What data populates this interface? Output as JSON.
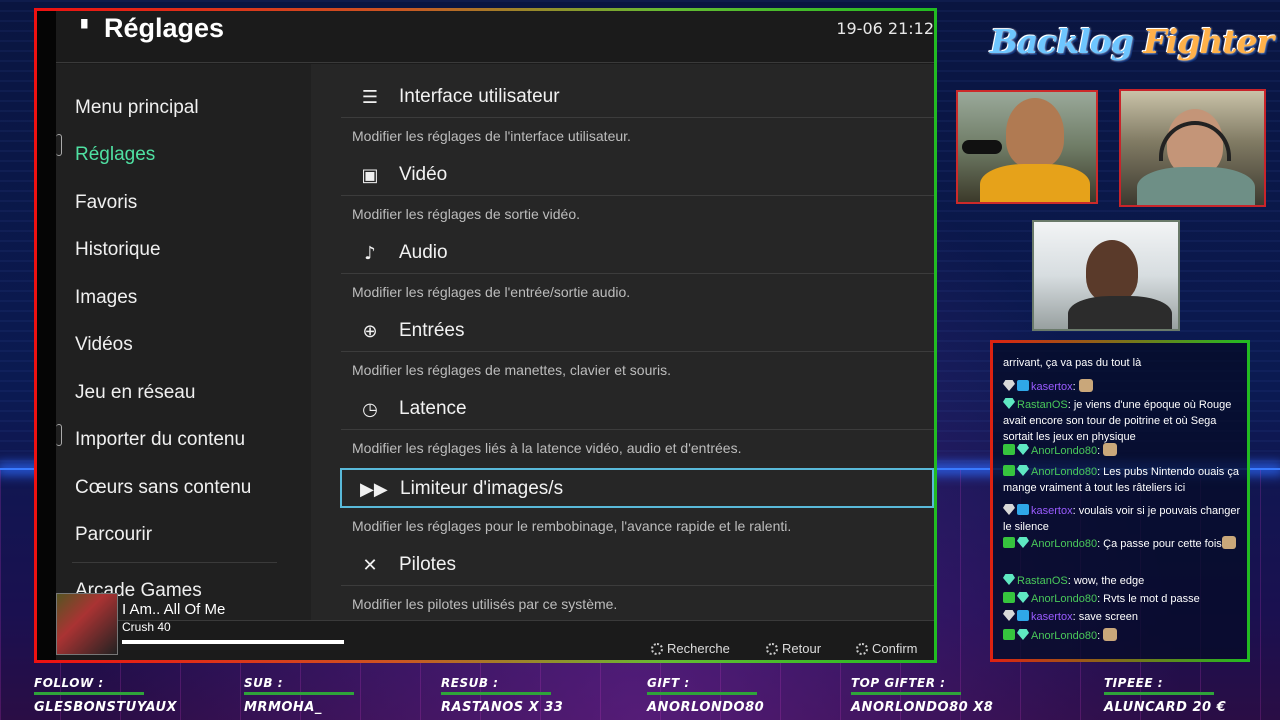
{
  "game": {
    "title": "Réglages",
    "clock": "19-06 21:12",
    "sidebar": [
      {
        "label": "Menu principal",
        "active": false
      },
      {
        "label": "Réglages",
        "active": true
      },
      {
        "label": "Favoris",
        "active": false
      },
      {
        "label": "Historique",
        "active": false
      },
      {
        "label": "Images",
        "active": false
      },
      {
        "label": "Vidéos",
        "active": false
      },
      {
        "label": "Jeu en réseau",
        "active": false
      },
      {
        "label": "Importer du contenu",
        "active": false
      },
      {
        "label": "Cœurs sans contenu",
        "active": false
      },
      {
        "label": "Parcourir",
        "active": false
      },
      {
        "label": "Arcade Games",
        "active": false
      }
    ],
    "settings": [
      {
        "icon": "list-icon",
        "glyph": "☰",
        "label": "Interface utilisateur",
        "desc": "Modifier les réglages de l'interface utilisateur."
      },
      {
        "icon": "film-icon",
        "glyph": "▣",
        "label": "Vidéo",
        "desc": "Modifier les réglages de sortie vidéo."
      },
      {
        "icon": "music-note-icon",
        "glyph": "♪",
        "label": "Audio",
        "desc": "Modifier les réglages de l'entrée/sortie audio."
      },
      {
        "icon": "gamepad-icon",
        "glyph": "⊕",
        "label": "Entrées",
        "desc": "Modifier les réglages de manettes, clavier et souris."
      },
      {
        "icon": "stopwatch-icon",
        "glyph": "◷",
        "label": "Latence",
        "desc": "Modifier les réglages liés à la latence vidéo, audio et d'entrées."
      },
      {
        "icon": "fast-forward-icon",
        "glyph": "▶▶",
        "label": "Limiteur d'images/s",
        "desc": "Modifier les réglages pour le rembobinage, l'avance rapide et le ralenti."
      },
      {
        "icon": "tools-icon",
        "glyph": "✕",
        "label": "Pilotes",
        "desc": "Modifier les pilotes utilisés par ce système."
      }
    ],
    "now_playing": {
      "title": "I Am.. All Of Me",
      "subtitle": "Crush 40"
    },
    "hints": [
      "Recherche",
      "Retour",
      "Confirm"
    ]
  },
  "logo": {
    "word1": "Backlog",
    "word2": "Fighter"
  },
  "chat": [
    {
      "badges": [],
      "user": "",
      "text": "arrivant, ça va pas du tout là",
      "user_color": ""
    },
    {
      "badges": [
        "b-gray",
        "b-crown"
      ],
      "user": "kasertox",
      "text": ": ",
      "emote": true,
      "user_color": "n-purple"
    },
    {
      "badges": [
        "b-dia"
      ],
      "user": "RastanOS",
      "text": ": je viens d'une époque où Rouge avait encore son tour de poitrine et où Sega sortait les jeux en physique",
      "user_color": "n-green"
    },
    {
      "badges": [
        "b-chk",
        "b-dia"
      ],
      "user": "AnorLondo80",
      "text": ": ",
      "emote": true,
      "user_color": "n-green"
    },
    {
      "badges": [
        "b-chk",
        "b-dia"
      ],
      "user": "AnorLondo80",
      "text": ": Les pubs Nintendo ouais ça mange vraiment à tout les râteliers ici",
      "user_color": "n-green"
    },
    {
      "badges": [
        "b-gray",
        "b-crown"
      ],
      "user": "kasertox",
      "text": ": voulais voir si je pouvais changer le silence",
      "user_color": "n-purple"
    },
    {
      "badges": [
        "b-chk",
        "b-dia"
      ],
      "user": "AnorLondo80",
      "text": ": Ça passe pour cette fois",
      "emote_after": true,
      "user_color": "n-green"
    },
    {
      "badges": [
        "b-dia"
      ],
      "user": "RastanOS",
      "text": ": wow, the edge",
      "user_color": "n-green"
    },
    {
      "badges": [
        "b-chk",
        "b-dia"
      ],
      "user": "AnorLondo80",
      "text": ": Rvts le mot d passe",
      "user_color": "n-green"
    },
    {
      "badges": [
        "b-gray",
        "b-crown"
      ],
      "user": "kasertox",
      "text": ": save screen",
      "user_color": "n-purple"
    },
    {
      "badges": [
        "b-chk",
        "b-dia"
      ],
      "user": "AnorLondo80",
      "text": ": ",
      "emote": true,
      "user_color": "n-green"
    }
  ],
  "ticker": [
    {
      "label": "FOLLOW :",
      "value": "GLESBONSTUYAUX"
    },
    {
      "label": "SUB :",
      "value": "MRMOHA_"
    },
    {
      "label": "RESUB :",
      "value": "RASTANOS X 33"
    },
    {
      "label": "GIFT :",
      "value": "ANORLONDO80"
    },
    {
      "label": "TOP GIFTER :",
      "value": "ANORLONDO80 X8"
    },
    {
      "label": "TIPEEE :",
      "value": "ALUNCARD 20 €"
    }
  ]
}
